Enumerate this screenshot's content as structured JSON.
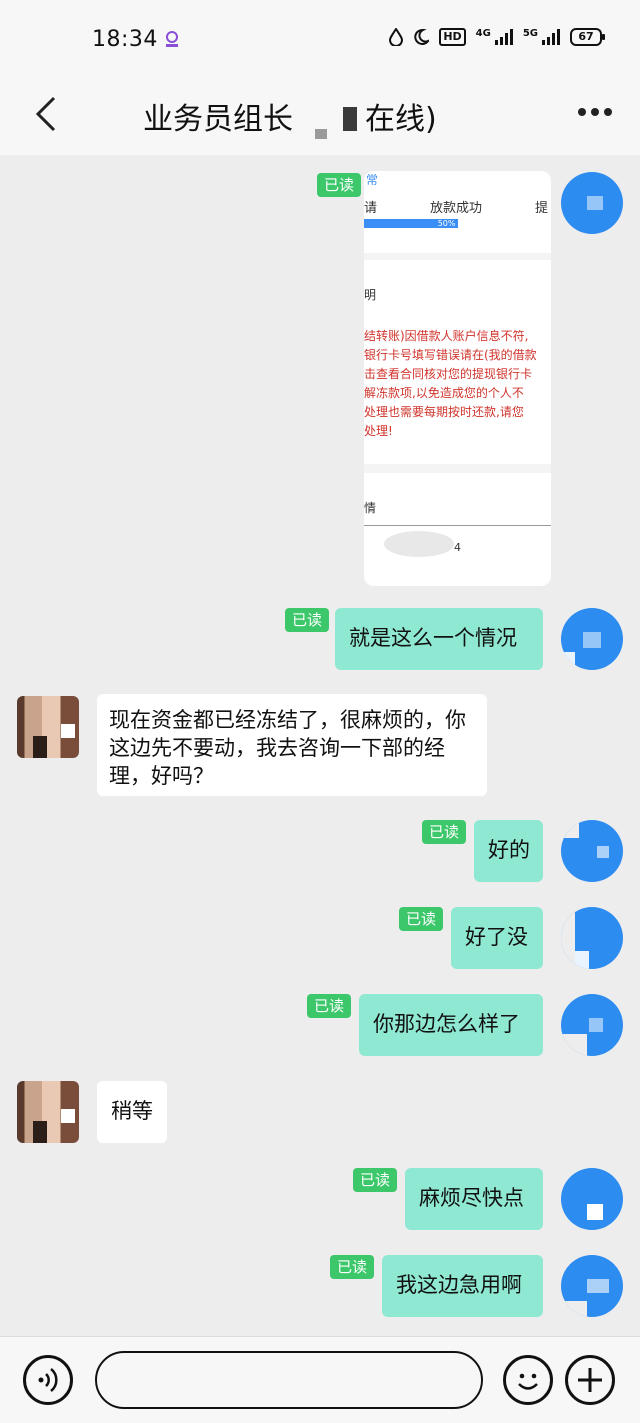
{
  "status_bar": {
    "time": "18:34",
    "hd_label": "HD",
    "net1": "4G",
    "net2": "5G",
    "battery": "67"
  },
  "header": {
    "title_part1": "业务员组长",
    "title_part2": "在线)"
  },
  "shared_image": {
    "tab1": "请",
    "tab2": "放款成功",
    "tab3": "提",
    "progress_label": "50%",
    "progress_value": 0.5,
    "section_label": "明",
    "warning_lines": [
      "结转账)因借款人账户信息不符,",
      "银行卡号填写错误请在(我的借款",
      "击查看合同核对您的提现银行卡",
      "解冻款项,以免造成您的个人不",
      "处理也需要每期按时还款,请您",
      "处理!"
    ],
    "section2_label": "情",
    "number": "4"
  },
  "messages": [
    {
      "from": "me",
      "text": "就是这么一个情况",
      "read": "已读"
    },
    {
      "from": "them",
      "text": "现在资金都已经冻结了，很麻烦的，你这边先不要动，我去咨询一下部的经理，好吗？"
    },
    {
      "from": "me",
      "text": "好的",
      "read": "已读"
    },
    {
      "from": "me",
      "text": "好了没",
      "read": "已读"
    },
    {
      "from": "me",
      "text": "你那边怎么样了",
      "read": "已读"
    },
    {
      "from": "them",
      "text": "稍等"
    },
    {
      "from": "me",
      "text": "麻烦尽快点",
      "read": "已读"
    },
    {
      "from": "me",
      "text": "我这边急用啊",
      "read": "已读"
    }
  ],
  "image_read": "已读",
  "input": {
    "placeholder": ""
  },
  "colors": {
    "my_bubble": "#8fe8d2",
    "read_badge": "#3cc76b",
    "avatar": "#2d8cf0"
  },
  "icons": [
    "back-arrow-icon",
    "more-icon",
    "voice-icon",
    "emoji-icon",
    "plus-icon"
  ]
}
